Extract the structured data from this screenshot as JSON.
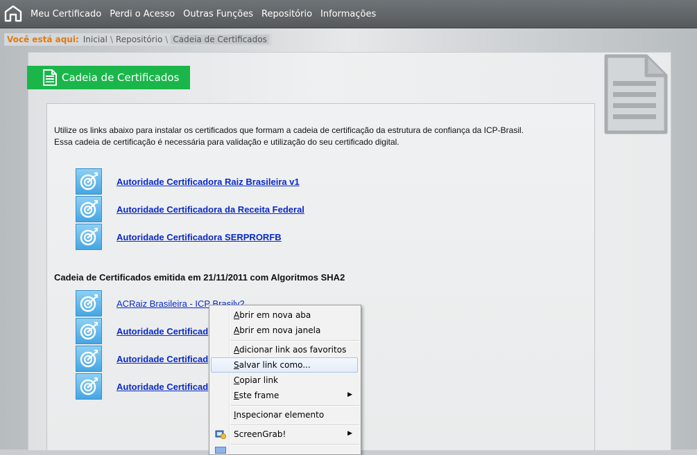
{
  "nav": {
    "items": [
      "Meu Certificado",
      "Perdi o Acesso",
      "Outras Funções",
      "Repositório",
      "Informações"
    ]
  },
  "breadcrumb": {
    "label": "Você está aqui:",
    "links": [
      "Inicial",
      "Repositório"
    ],
    "current": "Cadeia de Certificados",
    "sep": "\\"
  },
  "header": {
    "title": "Cadeia de Certificados"
  },
  "intro": {
    "line1": "Utilize os links abaixo para instalar os certificados que formam a cadeia de certificação da estrutura de confiança da ICP-Brasil.",
    "line2": "Essa cadeia de certificação é necessária para validação e utilização do seu certificado digital."
  },
  "certs_group1": [
    "Autoridade Certificadora Raiz Brasileira v1",
    "Autoridade Certificadora da Receita Federal",
    "Autoridade Certificadora SERPRORFB"
  ],
  "section2_title": "Cadeia de Certificados emitida em 21/11/2011 com Algoritmos SHA2",
  "certs_group2": [
    "ACRaiz Brasileira - ICP Brasilv2",
    "Autoridade Certificad",
    "Autoridade Certificad",
    "Autoridade Certificad"
  ],
  "context_menu": {
    "items": [
      {
        "pre": "",
        "key": "A",
        "post": "brir em nova aba"
      },
      {
        "pre": "",
        "key": "A",
        "post": "brir em nova janela"
      },
      {
        "pre": "",
        "key": "A",
        "post": "dicionar link aos favoritos"
      },
      {
        "pre": "",
        "key": "S",
        "post": "alvar link como..."
      },
      {
        "pre": "",
        "key": "C",
        "post": "opiar link"
      },
      {
        "pre": "",
        "key": "E",
        "post": "ste frame"
      },
      {
        "pre": "",
        "key": "I",
        "post": "nspecionar elemento"
      },
      {
        "pre": "",
        "key": "",
        "post": "ScreenGrab!"
      }
    ]
  },
  "colors": {
    "accent_green": "#1ab64a",
    "link_blue": "#0a29c7",
    "breadcrumb_orange": "#e07a12",
    "nav_bg": "#5f6367"
  }
}
